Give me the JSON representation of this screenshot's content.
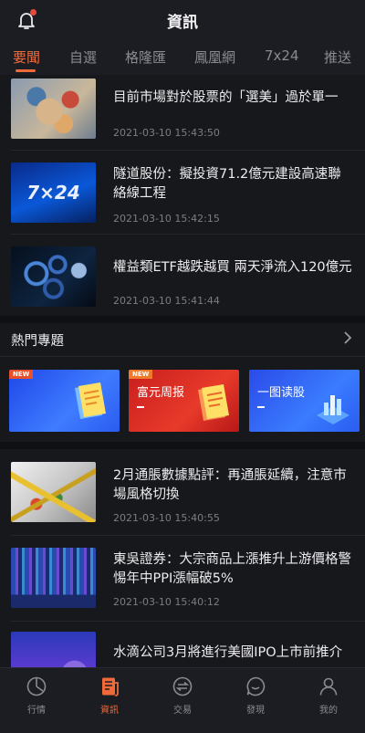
{
  "header": {
    "title": "資訊"
  },
  "tabs": [
    "要聞",
    "自選",
    "格隆匯",
    "鳳凰網",
    "7x24",
    "推送"
  ],
  "news_top": [
    {
      "headline": "目前市場對於股票的「選美」過於單一",
      "time": "2021-03-10 15:43:50"
    },
    {
      "headline": "隧道股份：擬投資71.2億元建設高速聯絡線工程",
      "time": "2021-03-10 15:42:15",
      "thumb_text": "7×24"
    },
    {
      "headline": "權益類ETF越跌越買 兩天淨流入120億元",
      "time": "2021-03-10 15:41:44"
    }
  ],
  "hot_topics": {
    "label": "熱門專題",
    "banners": [
      {
        "tag": "NEW",
        "title": ""
      },
      {
        "tag": "NEW",
        "title": "富元周报"
      },
      {
        "tag": "",
        "title": "一图读股"
      }
    ]
  },
  "news_bottom": [
    {
      "headline": "2月通脹數據點評：再通脹延續，注意市場風格切換",
      "time": "2021-03-10 15:40:55"
    },
    {
      "headline": "東吳證券：大宗商品上漲推升上游價格警惕年中PPI漲幅破5%",
      "time": "2021-03-10 15:40:12"
    },
    {
      "headline": "水滴公司3月將進行美國IPO上市前推介",
      "time": ""
    }
  ],
  "bottom_nav": [
    {
      "label": "行情",
      "icon": "chart-pie-icon"
    },
    {
      "label": "資訊",
      "icon": "news-icon"
    },
    {
      "label": "交易",
      "icon": "exchange-icon"
    },
    {
      "label": "發現",
      "icon": "discover-icon"
    },
    {
      "label": "我的",
      "icon": "user-icon"
    }
  ],
  "colors": {
    "accent": "#ef6a3a",
    "background": "#17181c",
    "notification": "#e84a3a"
  }
}
